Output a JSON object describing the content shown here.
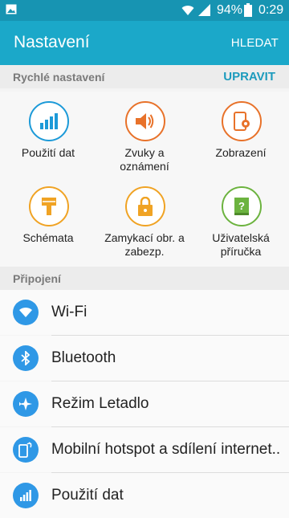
{
  "status_bar": {
    "battery_percent": "94%",
    "time": "0:29"
  },
  "app_bar": {
    "title": "Nastavení",
    "search_label": "HLEDAT"
  },
  "quick_settings": {
    "header": "Rychlé nastavení",
    "edit_label": "UPRAVIT",
    "tiles": [
      {
        "icon": "data-usage-icon",
        "label": "Použití dat",
        "color": "#1c9ad8"
      },
      {
        "icon": "sound-icon",
        "label": "Zvuky a oznámení",
        "color": "#e8722a"
      },
      {
        "icon": "display-icon",
        "label": "Zobrazení",
        "color": "#e8722a"
      },
      {
        "icon": "brush-icon",
        "label": "Schémata",
        "color": "#f0a324"
      },
      {
        "icon": "lock-icon",
        "label": "Zamykací obr. a zabezp.",
        "color": "#f0a324"
      },
      {
        "icon": "help-book-icon",
        "label": "Uživatelská příručka",
        "color": "#6cb33f"
      }
    ]
  },
  "connections": {
    "header": "Připojení",
    "items": [
      {
        "icon": "wifi-icon",
        "label": "Wi-Fi"
      },
      {
        "icon": "bluetooth-icon",
        "label": "Bluetooth"
      },
      {
        "icon": "airplane-icon",
        "label": "Režim Letadlo"
      },
      {
        "icon": "hotspot-icon",
        "label": "Mobilní hotspot a sdílení internet.."
      },
      {
        "icon": "data-usage-icon",
        "label": "Použití dat"
      }
    ]
  },
  "colors": {
    "status_bar": "#1794b2",
    "app_bar": "#1ba8c9",
    "accent": "#1c9bbd",
    "list_icon": "#2f98e6"
  }
}
